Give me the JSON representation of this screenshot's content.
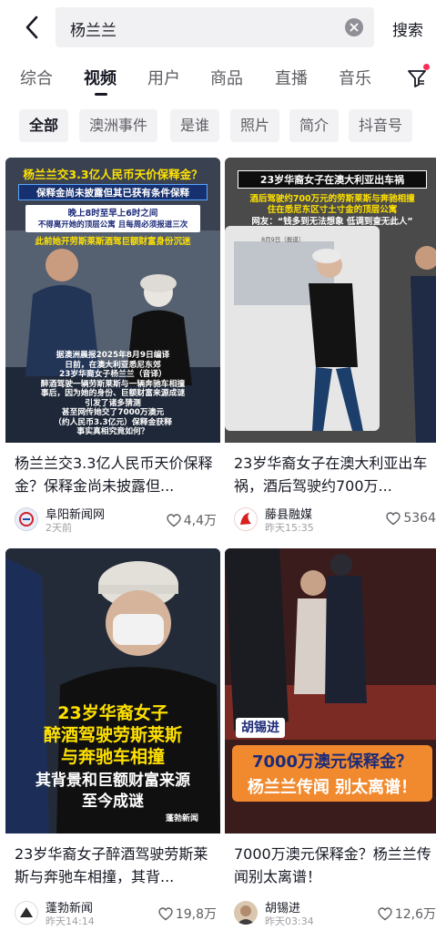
{
  "search": {
    "query": "杨兰兰",
    "button_label": "搜索"
  },
  "tabs": [
    {
      "label": "综合",
      "active": false
    },
    {
      "label": "视频",
      "active": true
    },
    {
      "label": "用户",
      "active": false
    },
    {
      "label": "商品",
      "active": false
    },
    {
      "label": "直播",
      "active": false
    },
    {
      "label": "音乐",
      "active": false
    }
  ],
  "chips": [
    {
      "label": "全部",
      "active": true
    },
    {
      "label": "澳洲事件"
    },
    {
      "label": "是谁"
    },
    {
      "label": "照片"
    },
    {
      "label": "简介"
    },
    {
      "label": "抖音号"
    }
  ],
  "cards": [
    {
      "title": "杨兰兰交3.3亿人民币天价保释金？保释金尚未披露但...",
      "author": "阜阳新闻网",
      "time": "2天前",
      "likes": "4,4万",
      "overlay": {
        "headline": "杨兰兰交3.3亿人民币天价保释金？",
        "sub": "保释金尚未披露但其已获有条件保释",
        "box1": "晚上8时至早上6时之间",
        "box2": "不得离开她的顶层公寓 且每周必须报道三次",
        "line": "此前她开劳斯莱斯酒驾巨额财富身份沉迷",
        "cap1": "据澳洲晨报2025年8月9日编译",
        "cap2": "日前，在澳大利亚悉尼东郊",
        "cap3": "23岁华裔女子杨兰兰（音译）",
        "cap4": "醉酒驾驶一辆劳斯莱斯与一辆奔驰车相撞",
        "cap5": "事后，因为她的身份、巨额财富来源成谜",
        "cap6": "引发了诸多猜测",
        "cap7": "甚至网传她交了7000万澳元",
        "cap8": "（约人民币3.3亿元）保释金获释",
        "cap9": "事实真相究竟如何？"
      }
    },
    {
      "title": "23岁华裔女子在澳大利亚出车祸，酒后驾驶约700万...",
      "author": "藤县融媒",
      "time": "昨天15:35",
      "likes": "5364",
      "overlay": {
        "headline": "23岁华裔女子在澳大利亚出车祸",
        "sub1": "酒后驾驶约700万元的劳斯莱斯与奔驰相撞",
        "sub2": "住在悉尼东区寸土寸金的顶层公寓",
        "netizen": "网友：“钱多到无法想象 低调到查无此人”",
        "date": "8月9日（报道）"
      }
    },
    {
      "title": "23岁华裔女子醉酒驾驶劳斯莱斯与奔驰车相撞，其背...",
      "author": "蓬勃新闻",
      "time": "昨天14:14",
      "likes": "19,8万",
      "overlay": {
        "line1": "23岁华裔女子",
        "line2": "醉酒驾驶劳斯莱斯",
        "line3": "与奔驰车相撞",
        "line4": "其背景和巨额财富来源",
        "line5": "至今成谜",
        "logo": "蓬勃新闻"
      }
    },
    {
      "title": "7000万澳元保释金？杨兰兰传闻别太离谱！",
      "author": "胡锡进",
      "time": "昨天03:34",
      "likes": "12,6万",
      "overlay": {
        "name_tag": "胡锡进",
        "line1": "7000万澳元保释金？",
        "line2": "杨兰兰传闻 别太离谱！"
      }
    }
  ],
  "icons": {
    "back": "back-arrow-icon",
    "clear": "clear-icon",
    "filter": "filter-icon",
    "like": "heart-icon"
  },
  "colors": {
    "accent_red": "#fe2c55",
    "text_primary": "#161823",
    "text_secondary": "#5d5d63",
    "chip_bg": "#f2f2f4"
  }
}
